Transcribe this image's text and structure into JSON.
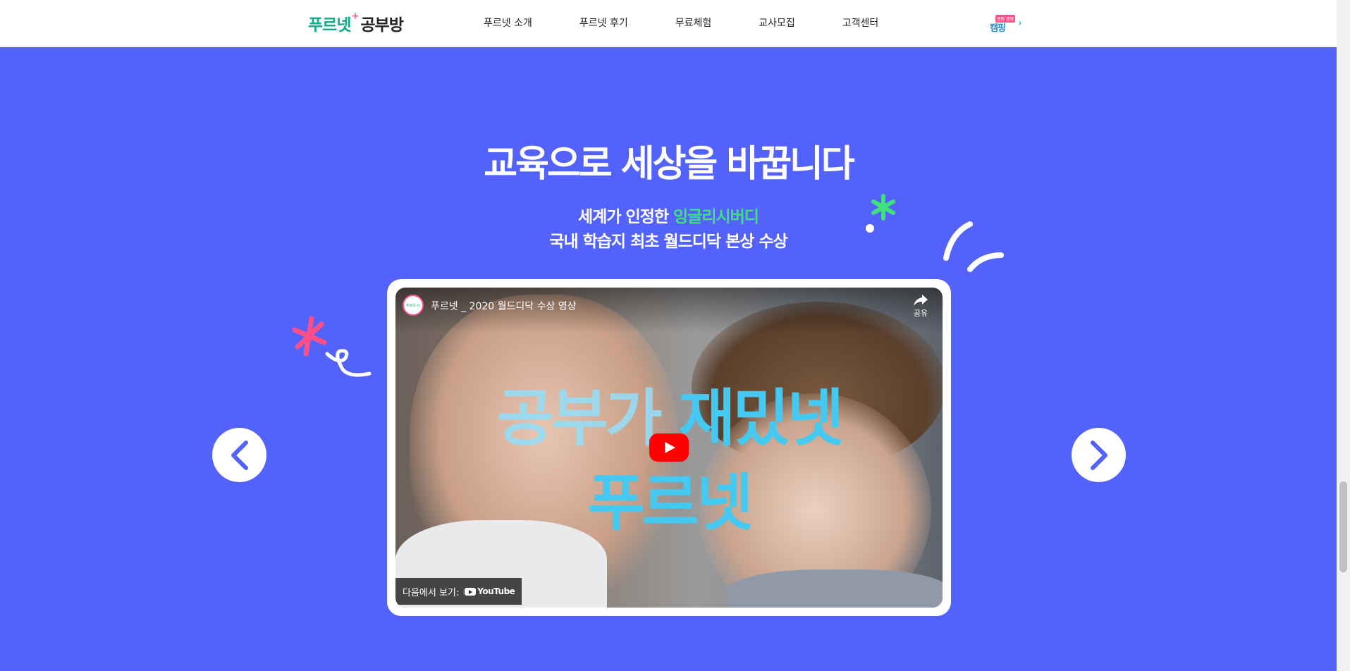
{
  "header": {
    "logo_brand": "푸르넷",
    "logo_plus": "+",
    "logo_sub": "공부방",
    "nav": [
      "푸르넷 소개",
      "푸르넷 후기",
      "무료체험",
      "교사모집",
      "고객센터"
    ],
    "camp_tag": "캠핑 캠핑",
    "camp_label": "캠핑",
    "camp_arrow": "›"
  },
  "hero": {
    "headline": "교육으로 세상을 바꿉니다",
    "sub1_prefix": "세계가 인정한 ",
    "sub1_accent": "잉글리시버디",
    "sub2": "국내 학습지 최초 월드디닥 본상 수상"
  },
  "video": {
    "channel_avatar_text": "푸르넷 tv",
    "title": "푸르넷 _ 2020 월드디닥 수상 영상",
    "share_label": "공유",
    "overlay_light": "공부가",
    "overlay_strong": "재밌넷",
    "overlay_line2": "푸르넷",
    "watch_on": "다음에서 보기:",
    "youtube": "YouTube"
  },
  "colors": {
    "background": "#5462fc",
    "brand_green": "#14a887",
    "accent_green": "#3de37a",
    "pink": "#ff4f88",
    "youtube_red": "#ff0000"
  },
  "icons": {
    "prev": "chevron-left-icon",
    "next": "chevron-right-icon",
    "share": "share-icon",
    "play": "play-icon"
  }
}
